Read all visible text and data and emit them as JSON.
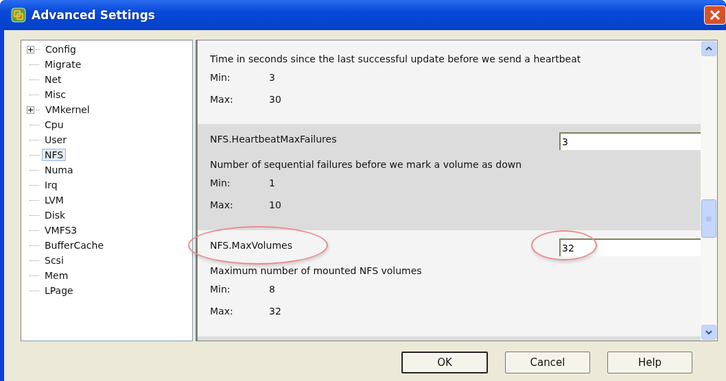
{
  "window": {
    "title": "Advanced Settings"
  },
  "tree": [
    {
      "label": "Config",
      "kind": "folder",
      "selected": false
    },
    {
      "label": "Migrate",
      "kind": "leaf",
      "selected": false
    },
    {
      "label": "Net",
      "kind": "leaf",
      "selected": false
    },
    {
      "label": "Misc",
      "kind": "leaf",
      "selected": false
    },
    {
      "label": "VMkernel",
      "kind": "folder",
      "selected": false
    },
    {
      "label": "Cpu",
      "kind": "leaf",
      "selected": false
    },
    {
      "label": "User",
      "kind": "leaf",
      "selected": false
    },
    {
      "label": "NFS",
      "kind": "leaf",
      "selected": true
    },
    {
      "label": "Numa",
      "kind": "leaf",
      "selected": false
    },
    {
      "label": "Irq",
      "kind": "leaf",
      "selected": false
    },
    {
      "label": "LVM",
      "kind": "leaf",
      "selected": false
    },
    {
      "label": "Disk",
      "kind": "leaf",
      "selected": false
    },
    {
      "label": "VMFS3",
      "kind": "leaf",
      "selected": false
    },
    {
      "label": "BufferCache",
      "kind": "leaf",
      "selected": false
    },
    {
      "label": "Scsi",
      "kind": "leaf",
      "selected": false
    },
    {
      "label": "Mem",
      "kind": "leaf",
      "selected": false
    },
    {
      "label": "LPage",
      "kind": "leaf",
      "selected": false
    }
  ],
  "settings": [
    {
      "description": "Time in seconds since the last successful update before we send a heartbeat",
      "min_label": "Min:",
      "min": "3",
      "max_label": "Max:",
      "max": "30",
      "shaded": false,
      "circled": false
    },
    {
      "name": "NFS.HeartbeatMaxFailures",
      "value": "3",
      "description": "Number of sequential failures before we mark a volume as down",
      "min_label": "Min:",
      "min": "1",
      "max_label": "Max:",
      "max": "10",
      "shaded": true,
      "circled": false
    },
    {
      "name": "NFS.MaxVolumes",
      "value": "32",
      "description": "Maximum number of mounted NFS volumes",
      "min_label": "Min:",
      "min": "8",
      "max_label": "Max:",
      "max": "32",
      "shaded": false,
      "circled": true
    }
  ],
  "buttons": [
    {
      "label": "OK",
      "default": true
    },
    {
      "label": "Cancel",
      "default": false
    },
    {
      "label": "Help",
      "default": false
    }
  ]
}
